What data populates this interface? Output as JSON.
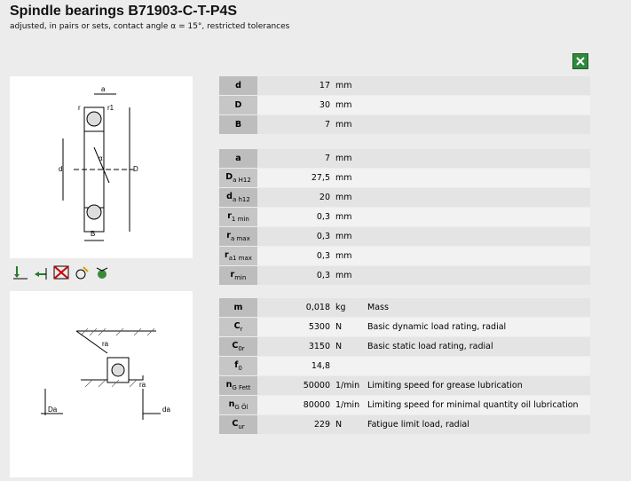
{
  "header": {
    "title": "Spindle bearings B71903-C-T-P4S",
    "subtitle": "adjusted, in pairs or sets, contact angle α = 15°, restricted tolerances"
  },
  "toolbar": {
    "export_icon": "excel-export-icon"
  },
  "drawing_labels": {
    "top": {
      "a": "a",
      "r": "r",
      "r1": "r1",
      "d": "d",
      "D": "D",
      "B": "B",
      "alpha": "α"
    },
    "bottom": {
      "ra": "ra",
      "ra2": "ra",
      "Da": "Da",
      "da": "da"
    }
  },
  "icon_names": [
    "axial-load-icon",
    "radial-load-icon",
    "no-relubrication-icon",
    "lubrication-icon",
    "sealing-icon"
  ],
  "dimensions": [
    {
      "sym": "d",
      "val": "17",
      "unit": "mm"
    },
    {
      "sym": "D",
      "val": "30",
      "unit": "mm"
    },
    {
      "sym": "B",
      "val": "7",
      "unit": "mm"
    }
  ],
  "mounting": [
    {
      "sym": "a",
      "val": "7",
      "unit": "mm"
    },
    {
      "sym": "D",
      "sub": "a H12",
      "val": "27,5",
      "unit": "mm"
    },
    {
      "sym": "d",
      "sub": "a h12",
      "val": "20",
      "unit": "mm"
    },
    {
      "sym": "r",
      "sub": "1 min",
      "val": "0,3",
      "unit": "mm"
    },
    {
      "sym": "r",
      "sub": "a max",
      "val": "0,3",
      "unit": "mm"
    },
    {
      "sym": "r",
      "sub": "a1 max",
      "val": "0,3",
      "unit": "mm"
    },
    {
      "sym": "r",
      "sub": "min",
      "val": "0,3",
      "unit": "mm"
    }
  ],
  "performance": [
    {
      "sym": "m",
      "val": "0,018",
      "unit": "kg",
      "desc": "Mass"
    },
    {
      "sym": "C",
      "sub": "r",
      "val": "5300",
      "unit": "N",
      "desc": "Basic dynamic load rating, radial"
    },
    {
      "sym": "C",
      "sub": "0r",
      "val": "3150",
      "unit": "N",
      "desc": "Basic static load rating, radial"
    },
    {
      "sym": "f",
      "sub": "0",
      "val": "14,8",
      "unit": "",
      "desc": ""
    },
    {
      "sym": "n",
      "sub": "G Fett",
      "val": "50000",
      "unit": "1/min",
      "desc": "Limiting speed for grease lubrication"
    },
    {
      "sym": "n",
      "sub": "G Öl",
      "val": "80000",
      "unit": "1/min",
      "desc": "Limiting speed for minimal quantity oil lubrication"
    },
    {
      "sym": "C",
      "sub": "ur",
      "val": "229",
      "unit": "N",
      "desc": "Fatigue limit load, radial"
    }
  ],
  "colors": {
    "background": "#ececec",
    "row_dark": "#e4e4e4",
    "row_light": "#f2f2f2",
    "symbol_cell": "#c6c6c6",
    "export_green": "#2f8a3a"
  }
}
